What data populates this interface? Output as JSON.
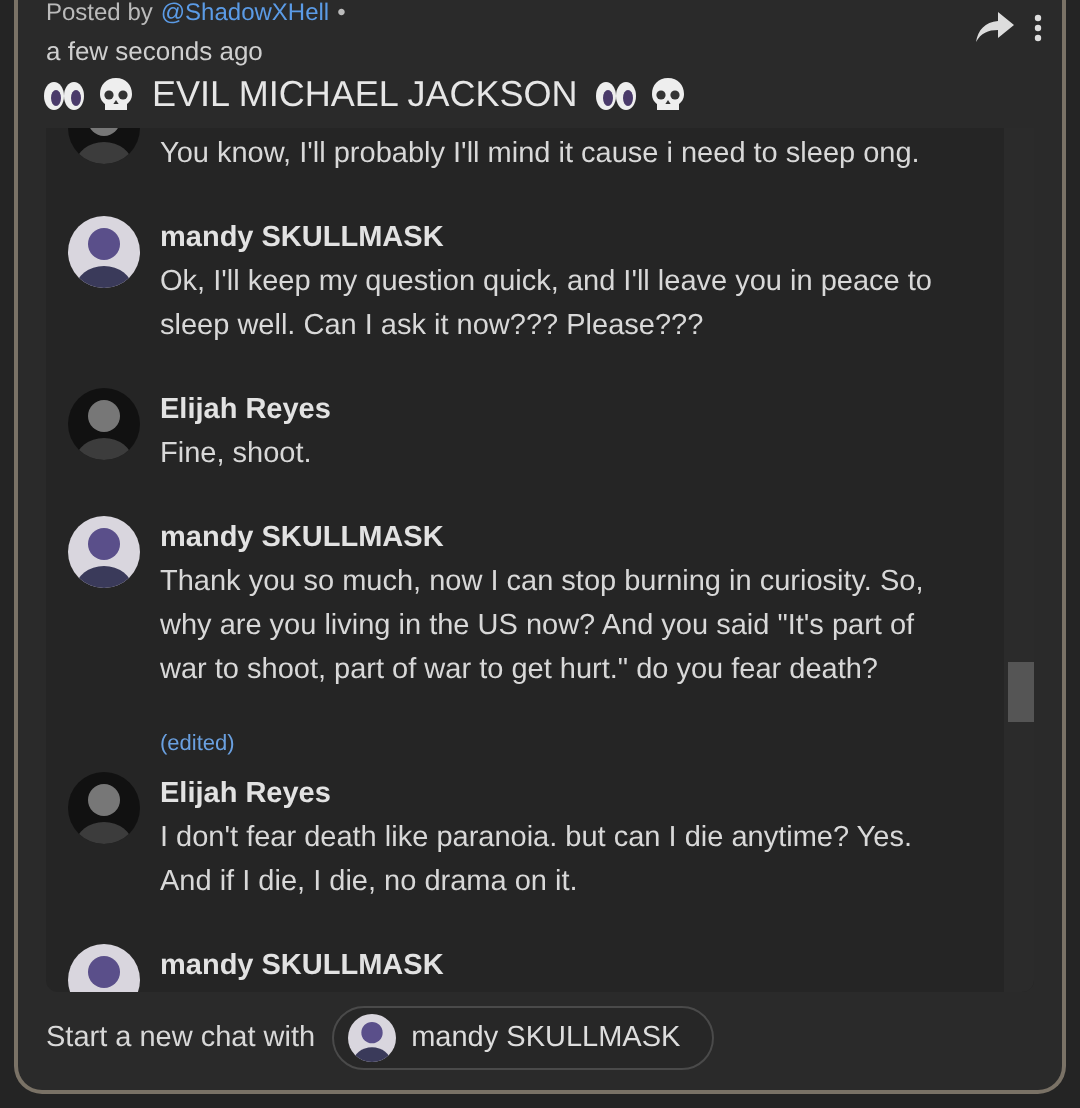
{
  "post": {
    "posted_by_label": "Posted by",
    "author": "@ShadowXHell",
    "separator": "•",
    "time": "a few seconds ago",
    "title": "EVIL MICHAEL JACKSON"
  },
  "messages": [
    {
      "kind": "dark",
      "text": "You know, I'll probably I'll mind it cause i need to sleep ong."
    },
    {
      "kind": "light",
      "name": "mandy SKULLMASK",
      "text": "Ok, I'll keep my question quick, and I'll leave you in peace to sleep well. Can I ask it now??? Please???"
    },
    {
      "kind": "dark",
      "name": "Elijah Reyes",
      "text": "Fine, shoot."
    },
    {
      "kind": "light",
      "name": "mandy SKULLMASK",
      "text": "Thank you so much, now I can stop burning in curiosity. So, why are you living in the US now? And you said \"It's part of war to shoot, part of war to get hurt.\" do you fear death?",
      "edited": "(edited)"
    },
    {
      "kind": "dark",
      "name": "Elijah Reyes",
      "text": "I don't fear death like paranoia. but can I die anytime? Yes. And if I die, I die, no drama on it."
    },
    {
      "kind": "light",
      "name": "mandy SKULLMASK"
    }
  ],
  "footer": {
    "label": "Start a new chat with",
    "chip": {
      "name": "mandy SKULLMASK"
    }
  }
}
